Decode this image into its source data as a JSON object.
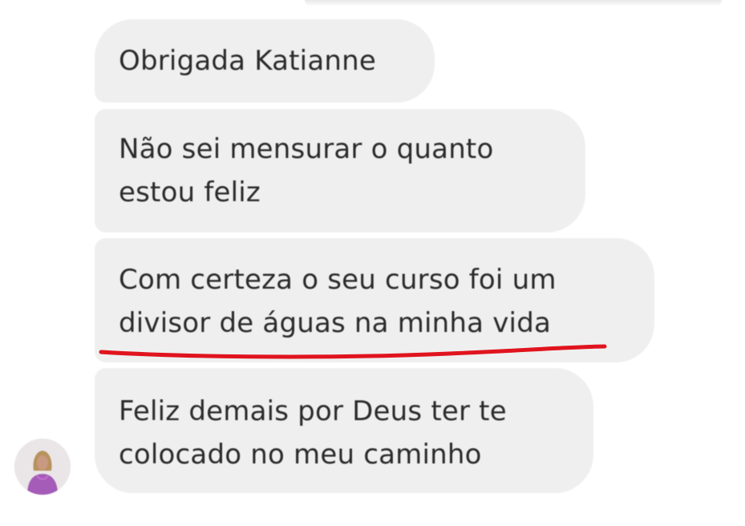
{
  "conversation": {
    "messages": [
      {
        "lines": [
          "Obrigada Katianne"
        ]
      },
      {
        "lines": [
          "Não sei mensurar o quanto",
          "estou feliz"
        ]
      },
      {
        "lines": [
          "Com certeza o seu curso foi um",
          "divisor de águas na minha vida"
        ],
        "highlighted": true
      },
      {
        "lines": [
          "Feliz demais por Deus ter te",
          "colocado no meu caminho"
        ]
      }
    ],
    "sender_avatar": "profile-photo",
    "bubble_color": "#efefef",
    "text_color": "#2b2b2b",
    "highlight_color": "#e0141e"
  }
}
